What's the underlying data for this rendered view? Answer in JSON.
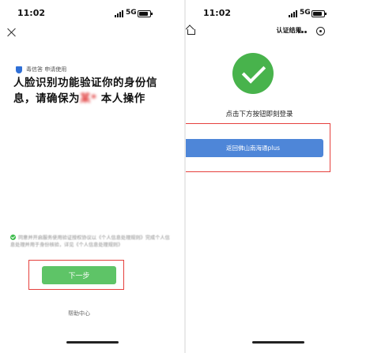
{
  "left": {
    "status": {
      "time": "11:02",
      "network": "5G"
    },
    "provider": "毒信答 申请使用",
    "headline_part1": "人脸识别功能验证你的身份信息，请确保为",
    "headline_name": "某*",
    "headline_part2": "本人操作",
    "consent": "同意并开启服务使用验证授权协议以《个人信息处理规则》完成个人信息处理并用于身份核验，详见《个人信息处理规则》",
    "next_label": "下一步",
    "help_label": "帮助中心"
  },
  "right": {
    "status": {
      "time": "11:02",
      "network": "5G"
    },
    "nav_title": "认证结果",
    "prompt": "点击下方按钮即刻登录",
    "return_label": "返回佛山南海通plus"
  },
  "colors": {
    "primary_green": "#5ec467",
    "success_green": "#48b34c",
    "primary_blue": "#4e86d8",
    "highlight_red": "#e5403d"
  }
}
